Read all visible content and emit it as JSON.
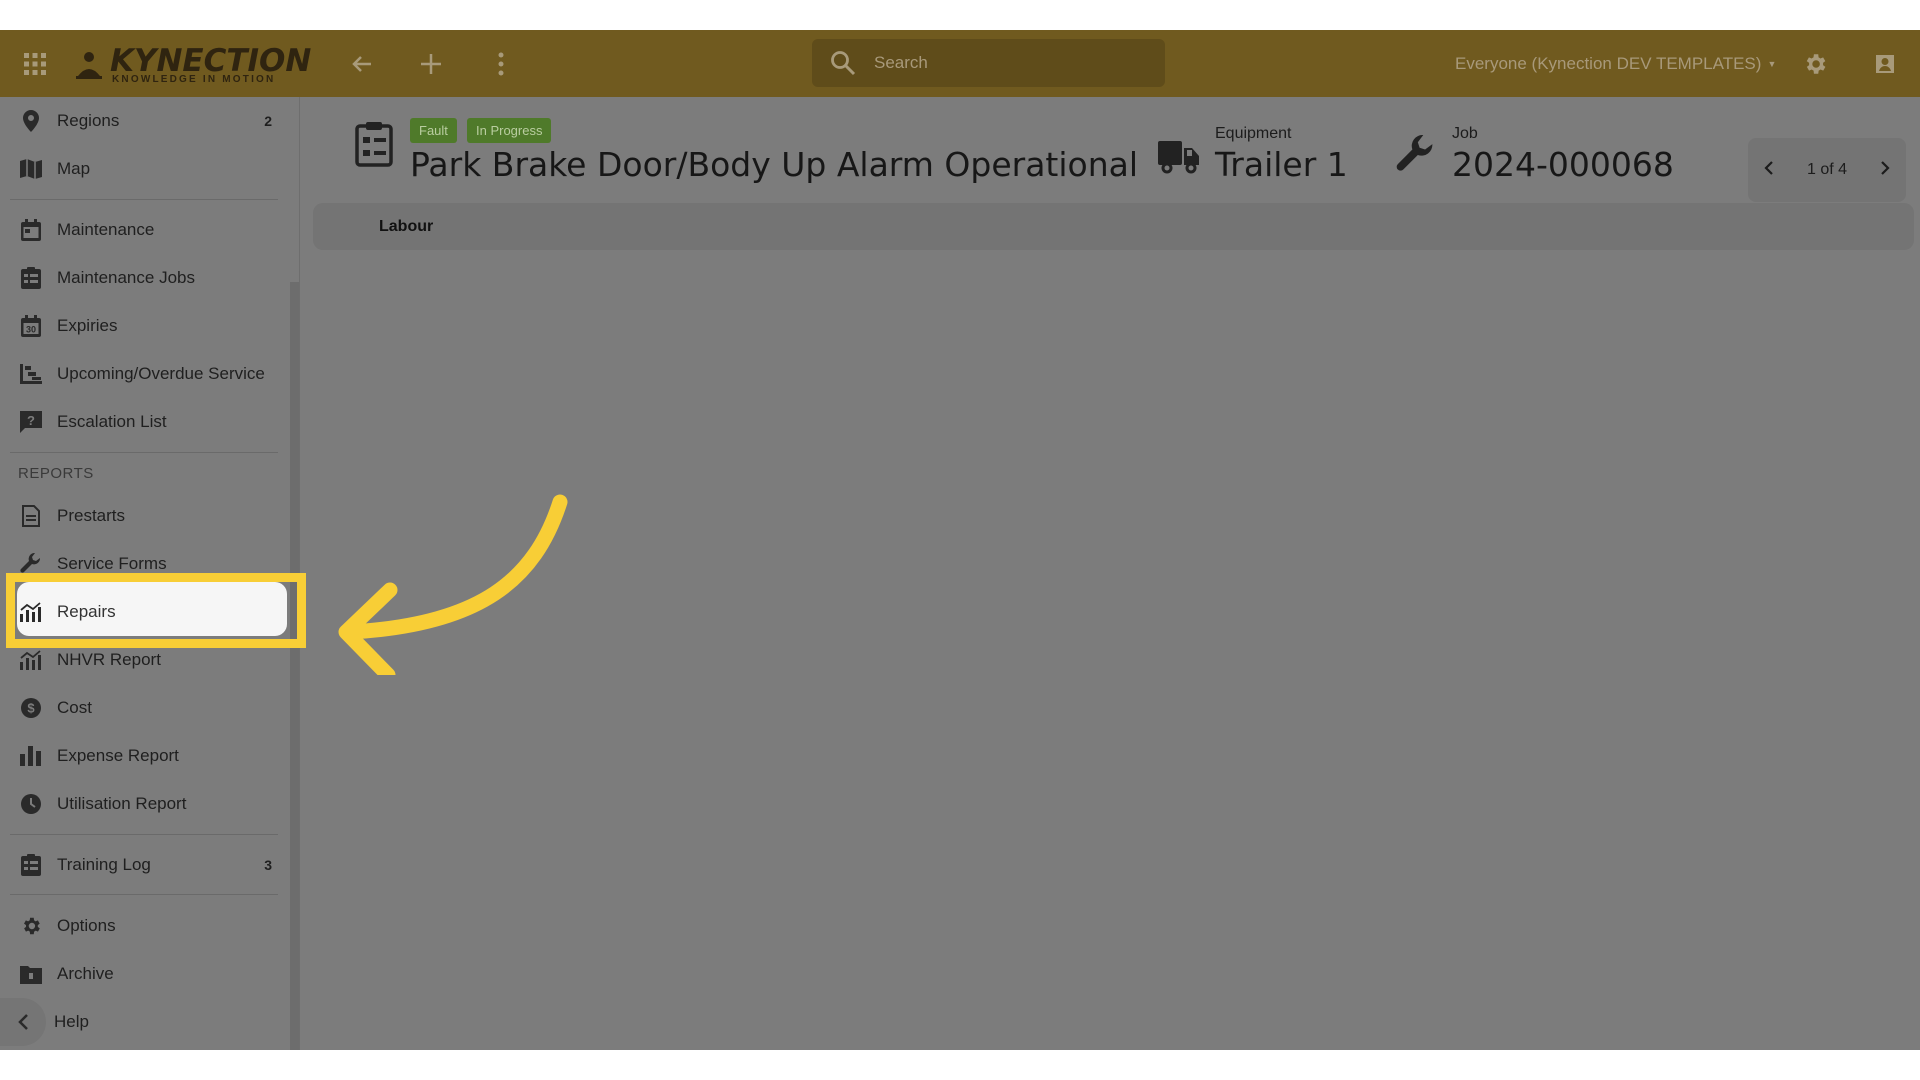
{
  "topbar": {
    "logo_text": "KYNECTION",
    "logo_tagline": "KNOWLEDGE IN MOTION",
    "search_placeholder": "Search",
    "account_label": "Everyone (Kynection DEV TEMPLATES)",
    "colors": {
      "bar": "#705a1f",
      "search_bg": "#5f4c1a"
    }
  },
  "sidebar": {
    "items": [
      {
        "label": "Regions",
        "badge": "2",
        "icon": "location-pin-icon"
      },
      {
        "label": "Map",
        "icon": "map-icon"
      },
      {
        "label": "Maintenance",
        "icon": "calendar-icon"
      },
      {
        "label": "Maintenance Jobs",
        "icon": "clipboard-list-icon"
      },
      {
        "label": "Expiries",
        "icon": "calendar-30-icon"
      },
      {
        "label": "Upcoming/Overdue Service",
        "icon": "stair-chart-icon"
      },
      {
        "label": "Escalation List",
        "icon": "question-bubble-icon"
      },
      {
        "label": "Prestarts",
        "icon": "document-icon"
      },
      {
        "label": "Service Forms",
        "icon": "wrench-icon"
      },
      {
        "label": "Repairs",
        "icon": "bar-line-chart-icon"
      },
      {
        "label": "NHVR Report",
        "icon": "bar-line-chart-icon"
      },
      {
        "label": "Cost",
        "icon": "dollar-circle-icon"
      },
      {
        "label": "Expense Report",
        "icon": "bar-chart-icon"
      },
      {
        "label": "Utilisation Report",
        "icon": "clock-icon"
      },
      {
        "label": "Training Log",
        "badge": "3",
        "icon": "clipboard-list-icon"
      },
      {
        "label": "Options",
        "icon": "gear-icon"
      },
      {
        "label": "Archive",
        "icon": "archive-folder-icon"
      },
      {
        "label": "Help",
        "icon": "chevron-left-icon"
      }
    ],
    "section_reports": "REPORTS",
    "highlight_color": "#f8ce36"
  },
  "record": {
    "tags": [
      "Fault",
      "In Progress"
    ],
    "title": "Park Brake Door/Body Up Alarm Operational",
    "equipment_label": "Equipment",
    "equipment_value": "Trailer 1",
    "job_label": "Job",
    "job_value": "2024-000068",
    "pager": "1 of 4",
    "tag_color": "#4f7a2a"
  },
  "tabs": {
    "labour": "Labour"
  },
  "annotation": {
    "arrow_color": "#f8ce36"
  }
}
